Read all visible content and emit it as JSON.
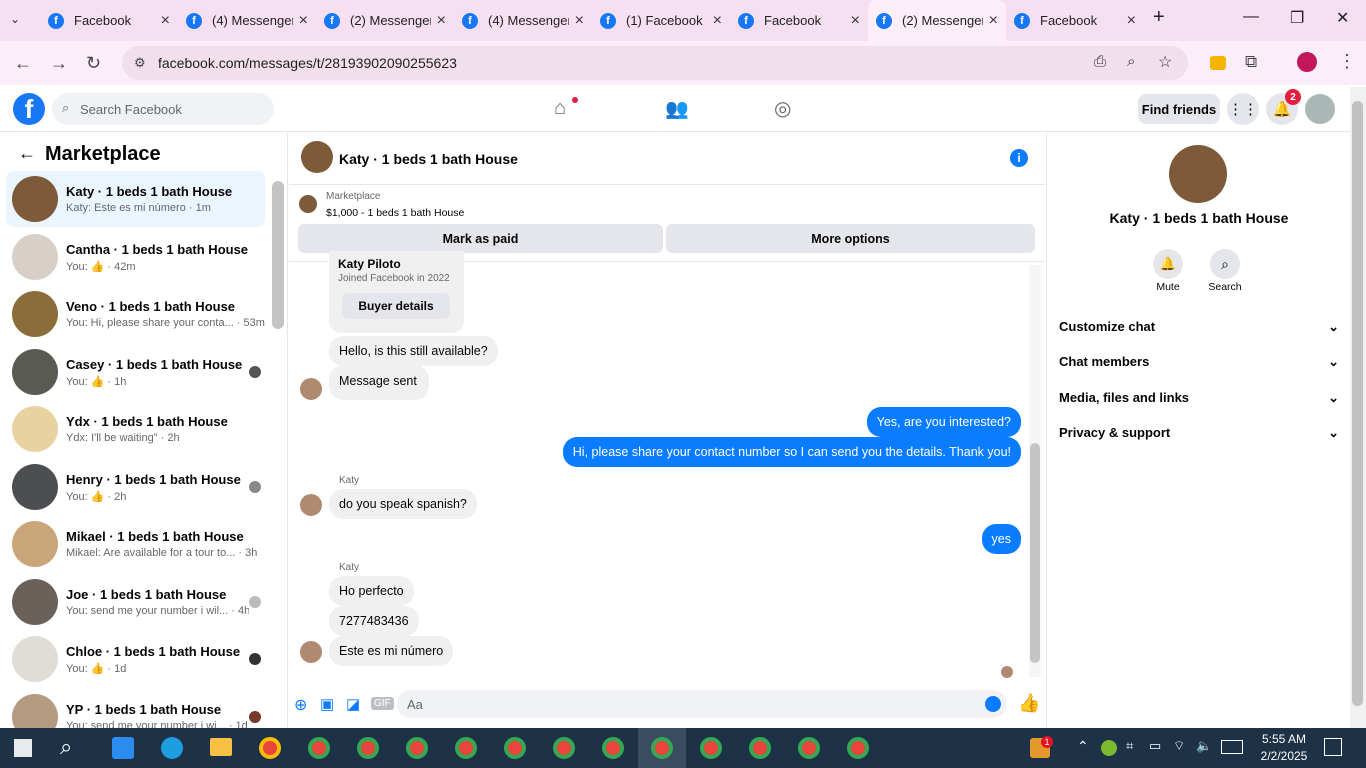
{
  "browser": {
    "tabs": [
      {
        "title": "Facebook",
        "active": false
      },
      {
        "title": "(4) Messenger",
        "active": false
      },
      {
        "title": "(2) Messenger",
        "active": false
      },
      {
        "title": "(4) Messenger",
        "active": false
      },
      {
        "title": "(1) Facebook",
        "active": false
      },
      {
        "title": "Facebook",
        "active": false
      },
      {
        "title": "(2) Messenger",
        "active": true
      },
      {
        "title": "Facebook",
        "active": false
      }
    ],
    "new_tab": "+",
    "url": "facebook.com/messages/t/28193902090255623"
  },
  "fb": {
    "search_placeholder": "Search Facebook",
    "find_friends": "Find friends",
    "notif_count": "2"
  },
  "marketplace": {
    "title": "Marketplace",
    "items": [
      {
        "name": "Katy · 1 beds 1 bath House",
        "sub": "Katy: Este es mi número · 1m"
      },
      {
        "name": "Cantha · 1 beds 1 bath House",
        "sub": "You: 👍 · 42m"
      },
      {
        "name": "Veno · 1 beds 1 bath House",
        "sub": "You: Hi, please share your conta... · 53m"
      },
      {
        "name": "Casey · 1 beds 1 bath House",
        "sub": "You: 👍 · 1h"
      },
      {
        "name": "Ydx · 1 beds 1 bath House",
        "sub": "Ydx: I'll be waiting\" · 2h"
      },
      {
        "name": "Henry · 1 beds 1 bath House",
        "sub": "You: 👍 · 2h"
      },
      {
        "name": "Mikael · 1 beds 1 bath House",
        "sub": "Mikael: Are available for a tour to... · 3h"
      },
      {
        "name": "Joe · 1 beds 1 bath House",
        "sub": "You: send me your number i wil... · 4h"
      },
      {
        "name": "Chloe · 1 beds 1 bath House",
        "sub": "You: 👍 · 1d"
      },
      {
        "name": "YP · 1 beds 1 bath House",
        "sub": "You: send me your number i wi... · 1d"
      }
    ]
  },
  "conversation": {
    "title": "Katy · 1 beds 1 bath House",
    "listing_label": "Marketplace",
    "listing_price": "$1,000 - 1 beds 1 bath House",
    "mark_paid": "Mark as paid",
    "more_options": "More options",
    "buyer_name": "Katy Piloto",
    "buyer_joined": "Joined Facebook in 2022",
    "buyer_details": "Buyer details",
    "sender": "Katy",
    "messages": [
      {
        "text": "Hello, is this still available?",
        "from": "them"
      },
      {
        "text": "Message sent",
        "from": "them"
      },
      {
        "text": "Yes, are you interested?",
        "from": "me"
      },
      {
        "text": "Hi, please share your contact number so I can send you the details. Thank you!",
        "from": "me"
      },
      {
        "text": "do you speak spanish?",
        "from": "them"
      },
      {
        "text": "yes",
        "from": "me"
      },
      {
        "text": "Ho perfecto",
        "from": "them"
      },
      {
        "text": "7277483436",
        "from": "them"
      },
      {
        "text": "Este es mi número",
        "from": "them"
      }
    ],
    "composer_placeholder": "Aa"
  },
  "details": {
    "name": "Katy · 1 beds 1 bath House",
    "mute": "Mute",
    "search": "Search",
    "sections": [
      "Customize chat",
      "Chat members",
      "Media, files and links",
      "Privacy & support"
    ]
  },
  "taskbar": {
    "time": "5:55 AM",
    "date": "2/2/2025",
    "badge": "1"
  },
  "colors": {
    "fb_blue": "#0a7cff",
    "tab_bg": "#f6dff0",
    "taskbar": "#1d3246"
  }
}
